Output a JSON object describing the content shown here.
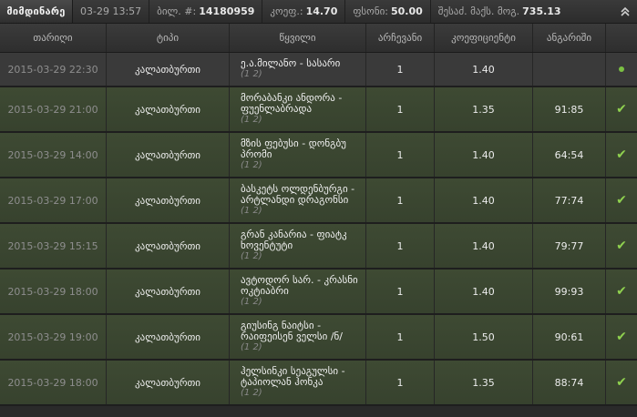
{
  "topbar": {
    "status_label": "მიმდინარე",
    "datetime": "03-29 13:57",
    "ticket_label": "ბილ. #:",
    "ticket_value": "14180959",
    "odds_label": "კოეფ.:",
    "odds_value": "14.70",
    "stake_label": "ფსონი:",
    "stake_value": "50.00",
    "maxwin_label": "შესაძ. მაქს. მოგ.",
    "maxwin_value": "735.13"
  },
  "columns": [
    "თარიღი",
    "ტიპი",
    "წყვილი",
    "არჩევანი",
    "კოეფიციენტი",
    "ანგარიში"
  ],
  "rows": [
    {
      "date": "2015-03-29 22:30",
      "type": "კალათბურთი",
      "event": "ე.ა.მილანო - სასარი",
      "sub": "(1 2)",
      "outcome": "1",
      "odds": "1.40",
      "score": "",
      "status": "pending"
    },
    {
      "date": "2015-03-29 21:00",
      "type": "კალათბურთი",
      "event": "მორაბანკი ანდორა - ფუენლაბრადა",
      "sub": "(1 2)",
      "outcome": "1",
      "odds": "1.35",
      "score": "91:85",
      "status": "won"
    },
    {
      "date": "2015-03-29 14:00",
      "type": "კალათბურთი",
      "event": "მზის ფებუსი - დონგბუ პრომი",
      "sub": "(1 2)",
      "outcome": "1",
      "odds": "1.40",
      "score": "64:54",
      "status": "won"
    },
    {
      "date": "2015-03-29 17:00",
      "type": "კალათბურთი",
      "event": "ბასკეტს ოლდენბურგი - არტლანდი დრაგონსი",
      "sub": "(1 2)",
      "outcome": "1",
      "odds": "1.40",
      "score": "77:74",
      "status": "won"
    },
    {
      "date": "2015-03-29 15:15",
      "type": "კალათბურთი",
      "event": "გრან კანარია - ფიატკ ხოვენტუტი",
      "sub": "(1 2)",
      "outcome": "1",
      "odds": "1.40",
      "score": "79:77",
      "status": "won"
    },
    {
      "date": "2015-03-29 18:00",
      "type": "კალათბურთი",
      "event": "ავტოდორ სარ. - კრასნი ოკტიაბრი",
      "sub": "(1 2)",
      "outcome": "1",
      "odds": "1.40",
      "score": "99:93",
      "status": "won"
    },
    {
      "date": "2015-03-29 19:00",
      "type": "კალათბურთი",
      "event": "გიუსინგ ნაიტსი - რაიფეისენ ველსი /ნ/",
      "sub": "(1 2)",
      "outcome": "1",
      "odds": "1.50",
      "score": "90:61",
      "status": "won"
    },
    {
      "date": "2015-03-29 18:00",
      "type": "კალათბურთი",
      "event": "ჰელსინკი სეაგულსი - ტაპიოლან ჰონკა",
      "sub": "(1 2)",
      "outcome": "1",
      "odds": "1.35",
      "score": "88:74",
      "status": "won"
    }
  ],
  "icons": {
    "collapse": "chevron-up-double-icon",
    "won": "checkmark-icon",
    "pending": "dot-icon"
  },
  "colors": {
    "won_row": "#3e4a33",
    "check": "#8fd14f",
    "dot": "#7bc043"
  }
}
